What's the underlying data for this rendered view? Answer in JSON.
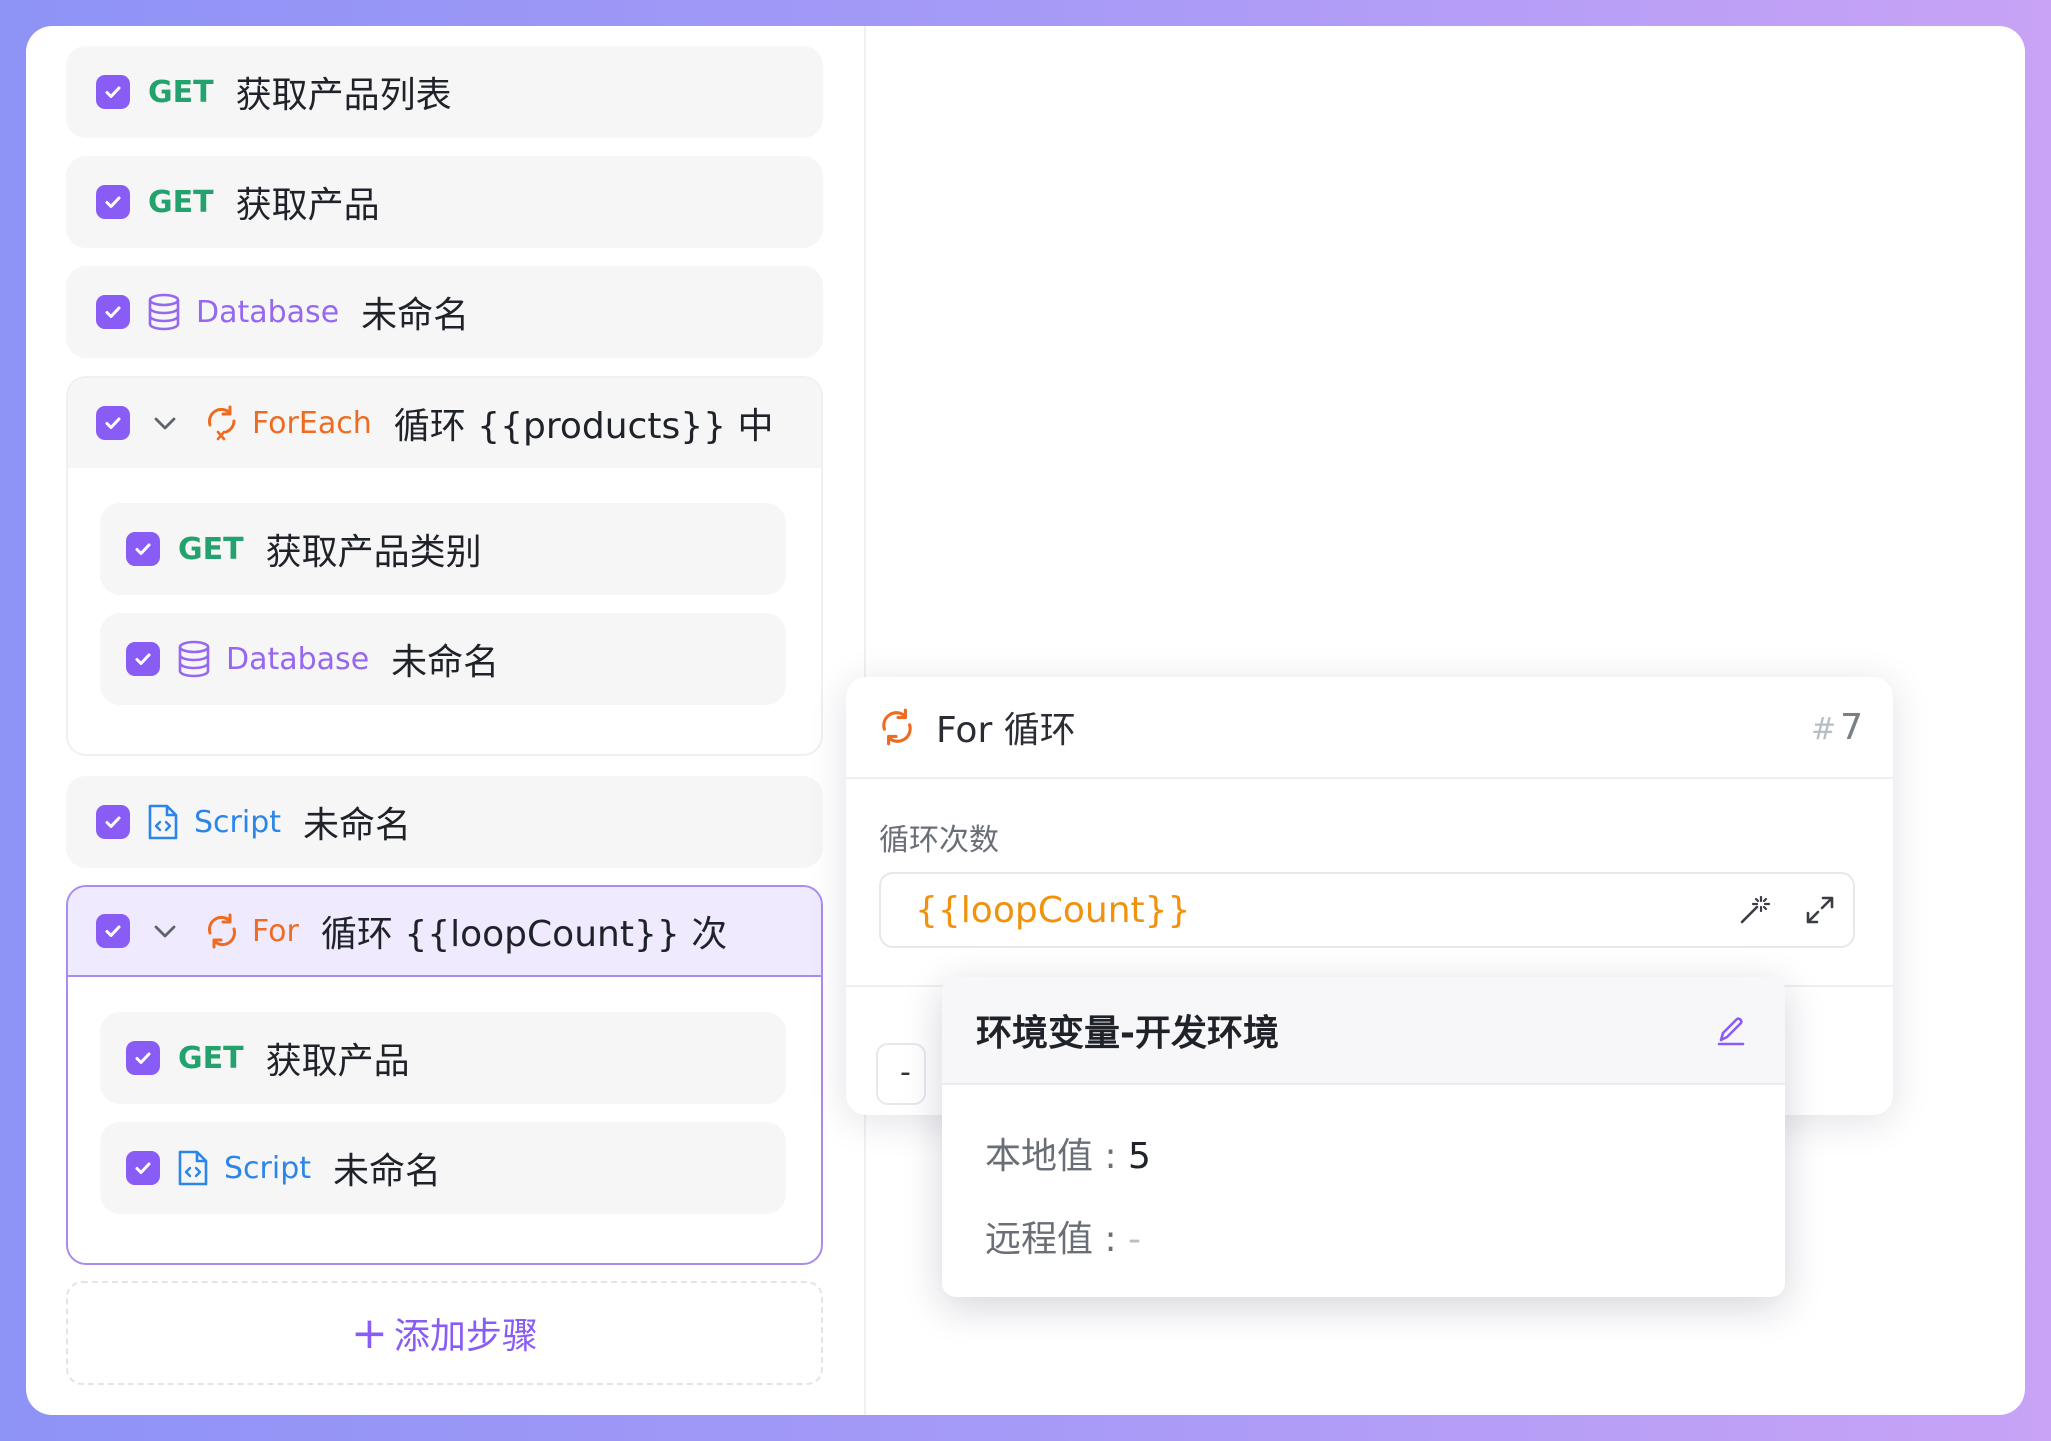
{
  "steps": {
    "s1": {
      "method": "GET",
      "label": "获取产品列表"
    },
    "s2": {
      "method": "GET",
      "label": "获取产品"
    },
    "s3": {
      "method": "Database",
      "label": "未命名"
    },
    "foreach": {
      "method": "ForEach",
      "label": "循环 {{products}} 中的元素",
      "children": [
        {
          "method": "GET",
          "label": "获取产品类别"
        },
        {
          "method": "Database",
          "label": "未命名"
        }
      ]
    },
    "s5": {
      "method": "Script",
      "label": "未命名"
    },
    "for": {
      "method": "For",
      "label": "循环 {{loopCount}} 次",
      "children": [
        {
          "method": "GET",
          "label": "获取产品"
        },
        {
          "method": "Script",
          "label": "未命名"
        }
      ]
    }
  },
  "add_step": {
    "label": "添加步骤",
    "icon": "plus-icon"
  },
  "panel": {
    "title": "For 循环",
    "id_hash": "#",
    "id_num": "7",
    "field_label": "循环次数",
    "field_value": "{{loopCount}}",
    "stub_text": "-"
  },
  "popover": {
    "title": "环境变量-开发环境",
    "local_label": "本地值 : ",
    "local_value": "5",
    "remote_label": "远程值 : ",
    "remote_value": "-"
  },
  "colors": {
    "accent": "#8a5cf6",
    "get": "#23a26d",
    "database": "#9668f0",
    "script": "#2b86e8",
    "loop": "#ee6c22",
    "variable": "#f1920f"
  }
}
